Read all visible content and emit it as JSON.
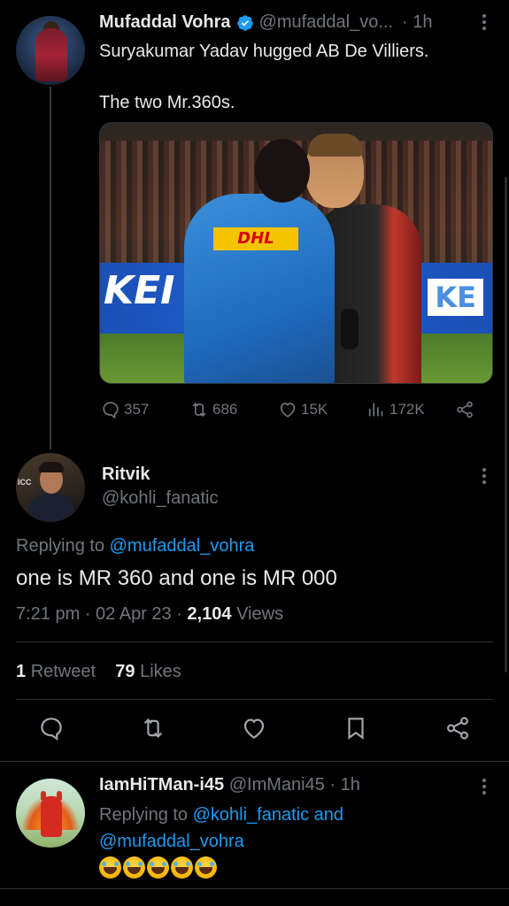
{
  "parent_tweet": {
    "name": "Mufaddal Vohra",
    "handle": "@mufaddal_vo...",
    "time": "· 1h",
    "text_line1": "Suryakumar Yadav hugged AB De Villiers.",
    "text_line2": "The two Mr.360s.",
    "image": {
      "sponsor_text": "DHL",
      "board_left": "KEI",
      "board_right": "KE"
    },
    "actions": {
      "replies": "357",
      "retweets": "686",
      "likes": "15K",
      "views": "172K"
    }
  },
  "main_tweet": {
    "name": "Ritvik",
    "handle": "@kohli_fanatic",
    "replying_prefix": "Replying to",
    "replying_mention": "@mufaddal_vohra",
    "text": "one is MR 360 and one is MR 000",
    "time": "7:21 pm · 02 Apr 23 ·",
    "views_count": "2,104",
    "views_label": "Views",
    "retweets_count": "1",
    "retweets_label": "Retweet",
    "likes_count": "79",
    "likes_label": "Likes",
    "avatar_badge": "ICC"
  },
  "reply_tweet": {
    "name": "IamHiTMan-i45",
    "handle": "@ImMani45",
    "time": "· 1h",
    "replying_prefix": "Replying to",
    "mention1": "@kohli_fanatic",
    "conjunction": "and",
    "mention2": "@mufaddal_vohra",
    "emoji_count": 5
  },
  "colors": {
    "background": "#000000",
    "text": "#e7e9ea",
    "secondary": "#71767b",
    "accent": "#1d9bf0",
    "divider": "#2f3336"
  }
}
